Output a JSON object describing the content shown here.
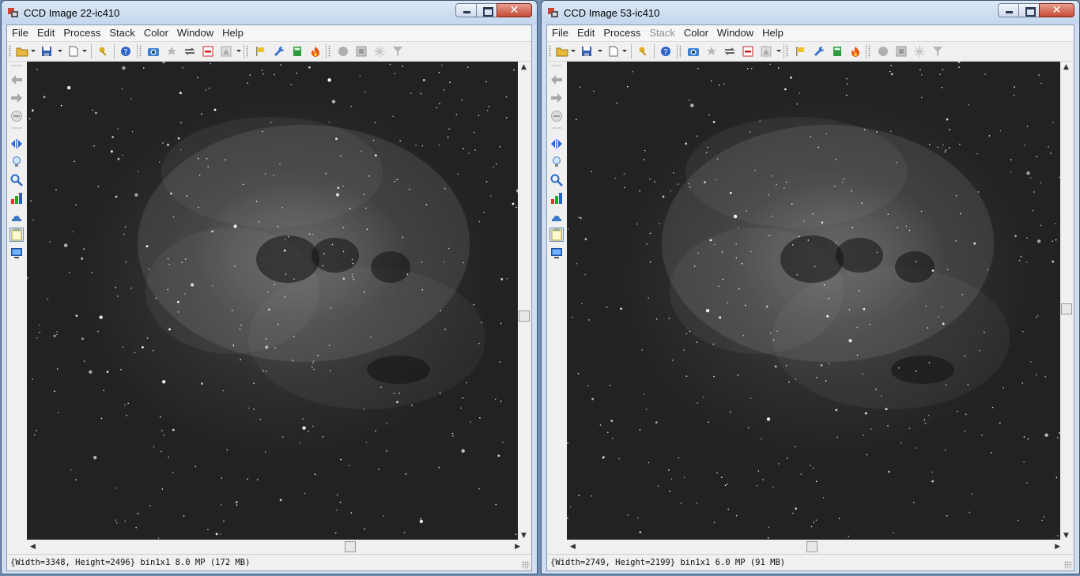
{
  "windows": [
    {
      "title": "CCD Image 22-ic410",
      "menu": [
        {
          "label": "File",
          "disabled": false
        },
        {
          "label": "Edit",
          "disabled": false
        },
        {
          "label": "Process",
          "disabled": false
        },
        {
          "label": "Stack",
          "disabled": false
        },
        {
          "label": "Color",
          "disabled": false
        },
        {
          "label": "Window",
          "disabled": false
        },
        {
          "label": "Help",
          "disabled": false
        }
      ],
      "status": "{Width=3348, Height=2496} bin1x1  8.0 MP  (172 MB)",
      "image_name": "ic410-nebula-22"
    },
    {
      "title": "CCD Image 53-ic410",
      "menu": [
        {
          "label": "File",
          "disabled": false
        },
        {
          "label": "Edit",
          "disabled": false
        },
        {
          "label": "Process",
          "disabled": false
        },
        {
          "label": "Stack",
          "disabled": true
        },
        {
          "label": "Color",
          "disabled": false
        },
        {
          "label": "Window",
          "disabled": false
        },
        {
          "label": "Help",
          "disabled": false
        }
      ],
      "status": "{Width=2749, Height=2199} bin1x1  6.0 MP  (91 MB)",
      "image_name": "ic410-nebula-53"
    }
  ],
  "toolbar_icons": [
    "open-folder-icon",
    "save-icon",
    "new-doc-icon",
    "key-icon",
    "help-icon",
    "camera-icon",
    "star-icon",
    "swap-icon",
    "minus-box-icon",
    "histogram-icon",
    "flag-icon",
    "wrench-icon",
    "calculator-icon",
    "flame-icon",
    "circle-icon",
    "square-icon",
    "starburst-icon",
    "filter-icon"
  ],
  "left_tool_icons": [
    "arrow-left-icon",
    "arrow-right-icon",
    "minus-circle-icon",
    "flip-horizontal-icon",
    "bulb-icon",
    "magnifier-icon",
    "bar-chart-icon",
    "mount-icon",
    "notepad-icon",
    "monitor-icon"
  ]
}
